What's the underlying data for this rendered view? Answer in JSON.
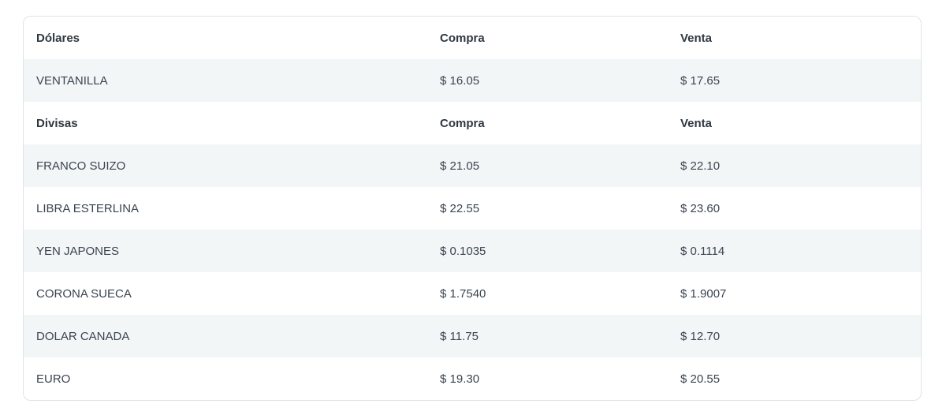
{
  "sections": [
    {
      "header": {
        "name": "Dólares",
        "buy": "Compra",
        "sell": "Venta"
      },
      "rows": [
        {
          "name": "VENTANILLA",
          "buy": "$ 16.05",
          "sell": "$ 17.65"
        }
      ]
    },
    {
      "header": {
        "name": "Divisas",
        "buy": "Compra",
        "sell": "Venta"
      },
      "rows": [
        {
          "name": "FRANCO SUIZO",
          "buy": "$ 21.05",
          "sell": "$ 22.10"
        },
        {
          "name": "LIBRA ESTERLINA",
          "buy": "$ 22.55",
          "sell": "$ 23.60"
        },
        {
          "name": "YEN JAPONES",
          "buy": "$ 0.1035",
          "sell": "$ 0.1114"
        },
        {
          "name": "CORONA SUECA",
          "buy": "$ 1.7540",
          "sell": "$ 1.9007"
        },
        {
          "name": "DOLAR CANADA",
          "buy": "$ 11.75",
          "sell": "$ 12.70"
        },
        {
          "name": "EURO",
          "buy": "$ 19.30",
          "sell": "$ 20.55"
        }
      ]
    }
  ],
  "colors": {
    "stripe": "#f2f6f7",
    "border": "#dfe3e8",
    "text": "#3b4450"
  }
}
